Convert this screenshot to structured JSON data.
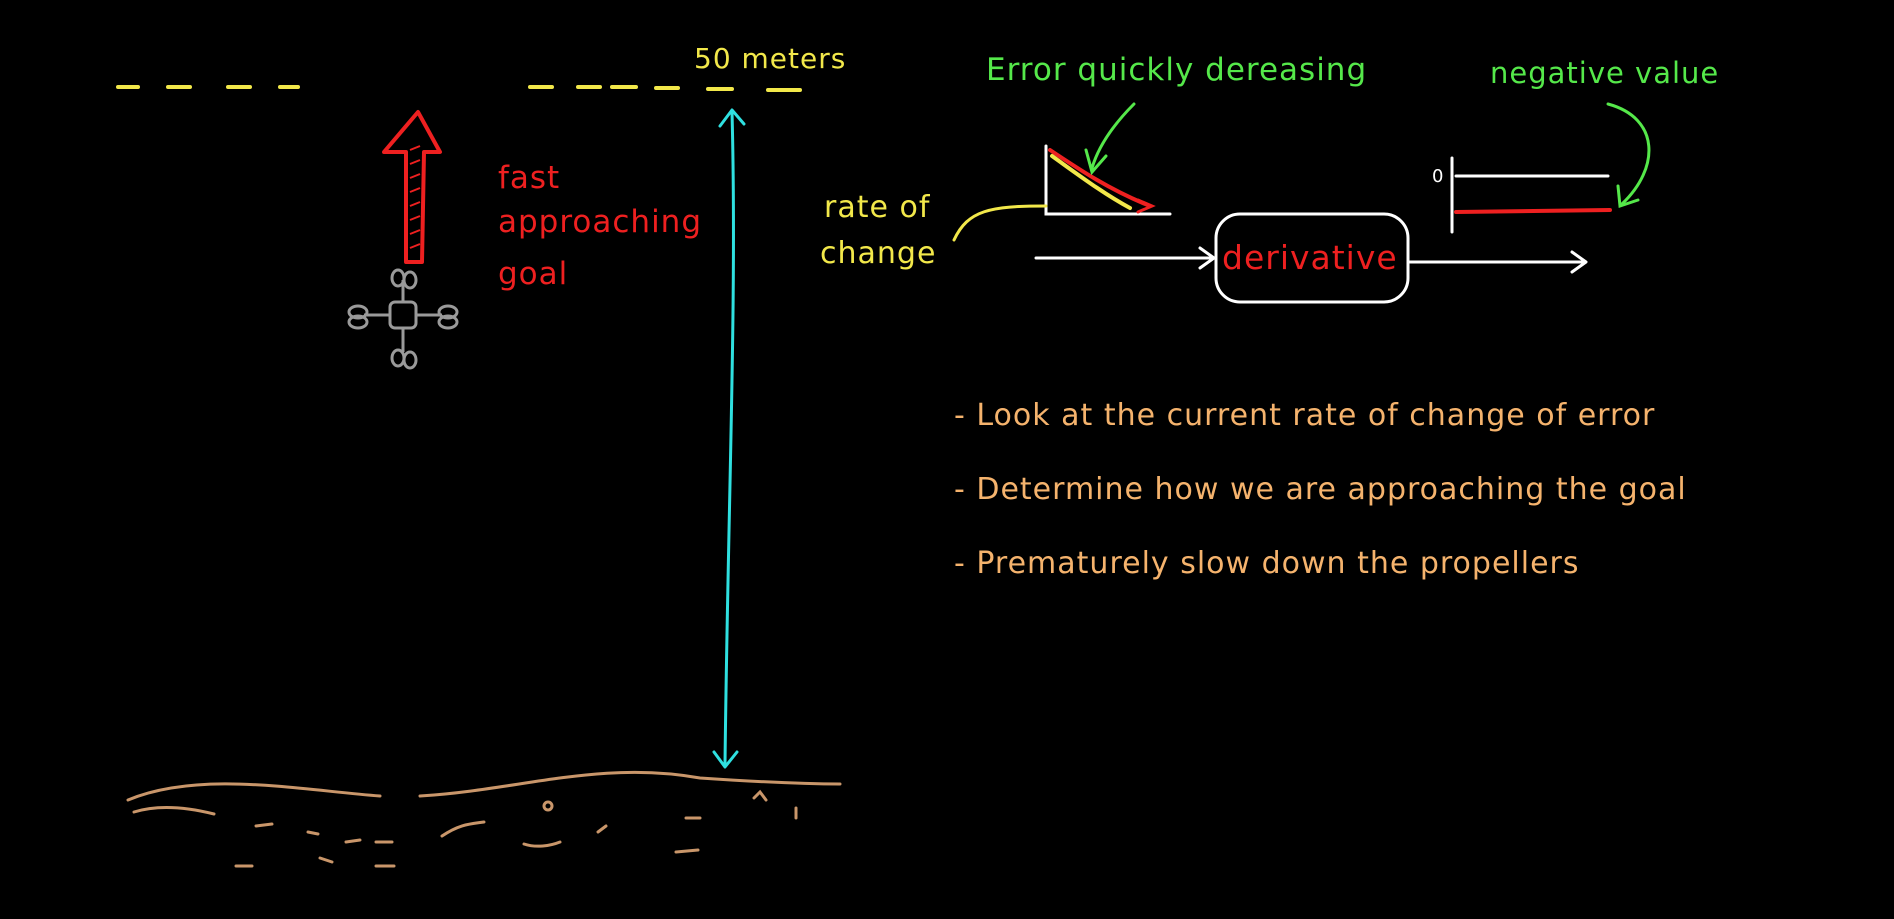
{
  "distance_label": "50 meters",
  "error_note": "Error quickly dereasing",
  "negative_note": "negative value",
  "zero_label": "0",
  "rate_label": [
    "rate of",
    "change"
  ],
  "fast_label": [
    "fast",
    "approaching",
    "goal"
  ],
  "block_label": "derivative",
  "bullets": [
    "- Look at the current rate of change of error",
    "- Determine how we are approaching the goal",
    "- Prematurely slow down the propellers"
  ],
  "colors": {
    "yellow": "#f2e84a",
    "green": "#55e84a",
    "red": "#ee2020",
    "cyan": "#2fe0e0",
    "orange": "#f5b36d",
    "white": "#ffffff",
    "ground": "#c9966a",
    "drone": "#9a9a9a"
  }
}
